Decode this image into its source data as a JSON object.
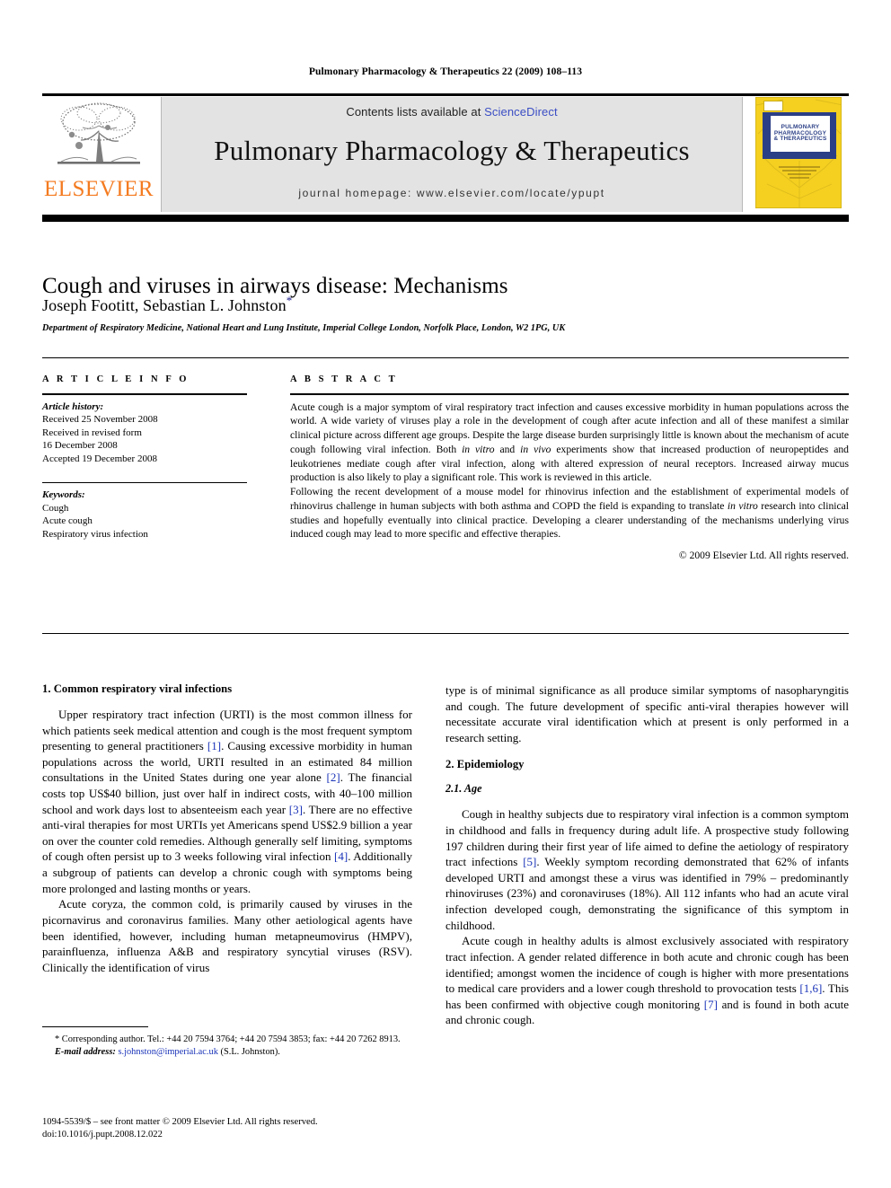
{
  "running_head": "Pulmonary Pharmacology & Therapeutics 22 (2009) 108–113",
  "masthead": {
    "publisher_name": "ELSEVIER",
    "publisher_logo_alt": "elsevier-tree-logo",
    "contents_prefix": "Contents lists available at ",
    "contents_link": "ScienceDirect",
    "journal_name": "Pulmonary Pharmacology & Therapeutics",
    "journal_homepage": "journal homepage: www.elsevier.com/locate/ypupt",
    "cover": {
      "line1": "PULMONARY",
      "line2": "PHARMACOLOGY",
      "line3": "& THERAPEUTICS",
      "brand_mark": "ELSEVIER"
    }
  },
  "article": {
    "title": "Cough and viruses in airways disease: Mechanisms",
    "authors": "Joseph Footitt, Sebastian L. Johnston",
    "corresponding_marker": "*",
    "affiliation": "Department of Respiratory Medicine, National Heart and Lung Institute, Imperial College London, Norfolk Place, London, W2 1PG, UK"
  },
  "article_info": {
    "heading": "A R T I C L E  I N F O",
    "history_label": "Article history:",
    "history": [
      "Received 25 November 2008",
      "Received in revised form",
      "16 December 2008",
      "Accepted 19 December 2008"
    ],
    "keywords_label": "Keywords:",
    "keywords": [
      "Cough",
      "Acute cough",
      "Respiratory virus infection"
    ]
  },
  "abstract": {
    "heading": "A B S T R A C T",
    "paragraph1": "Acute cough is a major symptom of viral respiratory tract infection and causes excessive morbidity in human populations across the world. A wide variety of viruses play a role in the development of cough after acute infection and all of these manifest a similar clinical picture across different age groups. Despite the large disease burden surprisingly little is known about the mechanism of acute cough following viral infection. Both in vitro and in vivo experiments show that increased production of neuropeptides and leukotrienes mediate cough after viral infection, along with altered expression of neural receptors. Increased airway mucus production is also likely to play a significant role. This work is reviewed in this article.",
    "paragraph2": "Following the recent development of a mouse model for rhinovirus infection and the establishment of experimental models of rhinovirus challenge in human subjects with both asthma and COPD the field is expanding to translate in vitro research into clinical studies and hopefully eventually into clinical practice. Developing a clearer understanding of the mechanisms underlying virus induced cough may lead to more specific and effective therapies.",
    "copyright": "© 2009 Elsevier Ltd. All rights reserved."
  },
  "body": {
    "section1_heading": "1. Common respiratory viral infections",
    "left_p1": "Upper respiratory tract infection (URTI) is the most common illness for which patients seek medical attention and cough is the most frequent symptom presenting to general practitioners [1]. Causing excessive morbidity in human populations across the world, URTI resulted in an estimated 84 million consultations in the United States during one year alone [2]. The financial costs top US$40 billion, just over half in indirect costs, with 40–100 million school and work days lost to absenteeism each year [3]. There are no effective anti-viral therapies for most URTIs yet Americans spend US$2.9 billion a year on over the counter cold remedies. Although generally self limiting, symptoms of cough often persist up to 3 weeks following viral infection [4]. Additionally a subgroup of patients can develop a chronic cough with symptoms being more prolonged and lasting months or years.",
    "left_p2": "Acute coryza, the common cold, is primarily caused by viruses in the picornavirus and coronavirus families. Many other aetiological agents have been identified, however, including human metapneumovirus (HMPV), parainfluenza, influenza A&B and respiratory syncytial viruses (RSV). Clinically the identification of virus",
    "right_p1": "type is of minimal significance as all produce similar symptoms of nasopharyngitis and cough. The future development of specific anti-viral therapies however will necessitate accurate viral identification which at present is only performed in a research setting.",
    "section2_heading": "2. Epidemiology",
    "subsection21_heading": "2.1. Age",
    "right_p2": "Cough in healthy subjects due to respiratory viral infection is a common symptom in childhood and falls in frequency during adult life. A prospective study following 197 children during their first year of life aimed to define the aetiology of respiratory tract infections [5]. Weekly symptom recording demonstrated that 62% of infants developed URTI and amongst these a virus was identified in 79% – predominantly rhinoviruses (23%) and coronaviruses (18%). All 112 infants who had an acute viral infection developed cough, demonstrating the significance of this symptom in childhood.",
    "right_p3": "Acute cough in healthy adults is almost exclusively associated with respiratory tract infection. A gender related difference in both acute and chronic cough has been identified; amongst women the incidence of cough is higher with more presentations to medical care providers and a lower cough threshold to provocation tests [1,6]. This has been confirmed with objective cough monitoring [7] and is found in both acute and chronic cough."
  },
  "footnote": {
    "corresponding": "* Corresponding author. Tel.: +44 20 7594 3764; +44 20 7594 3853; fax: +44 20 7262 8913.",
    "email_label": "E-mail address:",
    "email": "s.johnston@imperial.ac.uk",
    "email_suffix": "(S.L. Johnston)."
  },
  "imprint": {
    "line1": "1094-5539/$ – see front matter © 2009 Elsevier Ltd. All rights reserved.",
    "line2": "doi:10.1016/j.pupt.2008.12.022"
  }
}
